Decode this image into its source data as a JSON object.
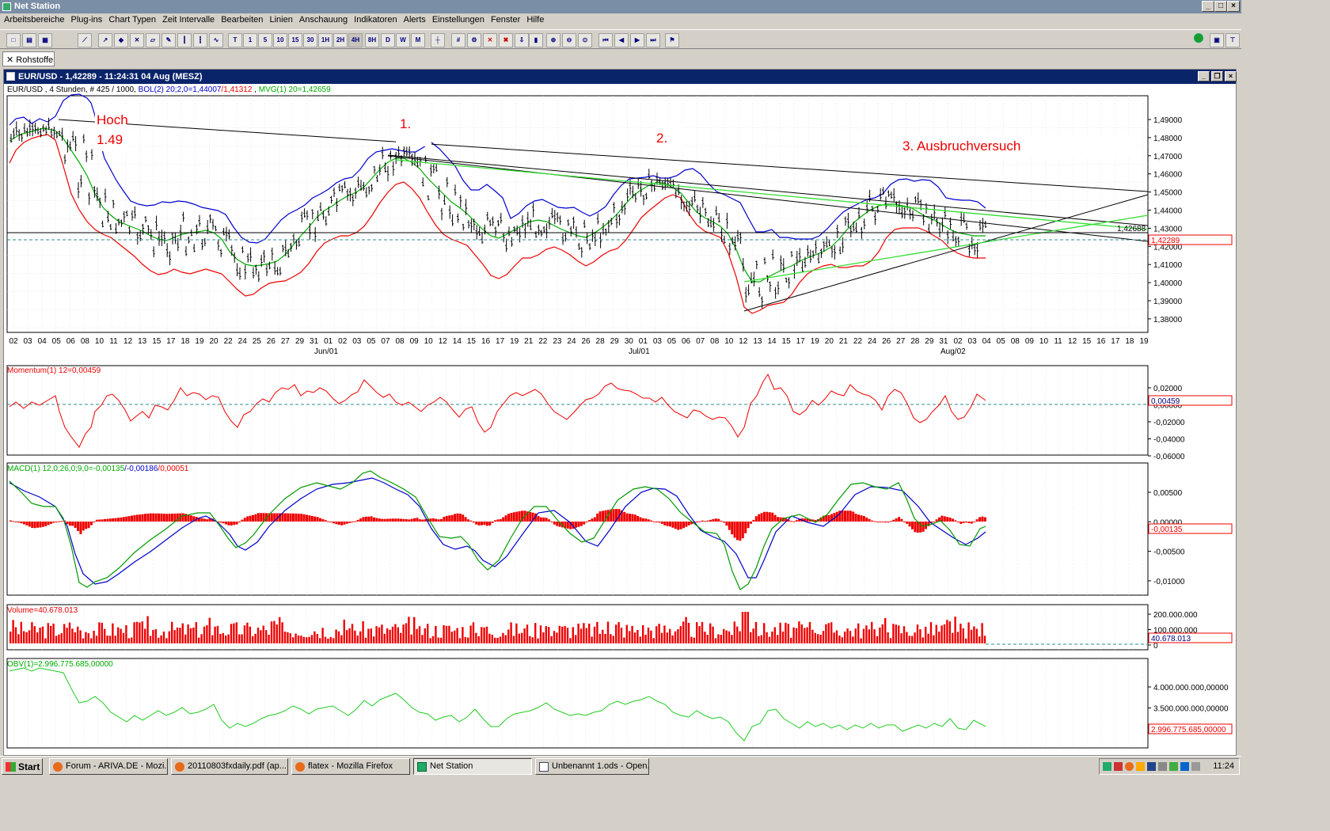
{
  "app": {
    "title": "Net Station"
  },
  "menu": [
    "Arbeitsbereiche",
    "Plug-ins",
    "Chart Typen",
    "Zeit Intervalle",
    "Bearbeiten",
    "Linien",
    "Anschauung",
    "Indikatoren",
    "Alerts",
    "Einstellungen",
    "Fenster",
    "Hilfe"
  ],
  "toolbar": {
    "intervals": [
      "T",
      "1",
      "5",
      "10",
      "15",
      "30",
      "1H",
      "2H",
      "4H",
      "8H",
      "D",
      "W",
      "M"
    ]
  },
  "tab": {
    "label": "Rohstoffe"
  },
  "chart_window": {
    "title": "EUR/USD - 1,42289 - 11:24:31  04 Aug (MESZ)"
  },
  "price_panel": {
    "info_prefix": "EUR/USD , 4 Stunden, # 425 / 1000, ",
    "bol_label": "BOL(2) 20;2,0=1,44007",
    "bol_lower": "/1,41312",
    "mvg_label": "MVG(1) 20=1,42659",
    "y_ticks": [
      "1,49000",
      "1,48000",
      "1,47000",
      "1,46000",
      "1,45000",
      "1,44000",
      "1,43000",
      "1,42000",
      "1,41000",
      "1,40000",
      "1,39000",
      "1,38000"
    ],
    "last_price": "1,42289",
    "line_price": "1,42688",
    "annotations": {
      "hoch": "Hoch",
      "hoch_value": "1.49",
      "first": "1.",
      "second": "2.",
      "third": "3. Ausbruchversuch"
    },
    "x_ticks": [
      "02",
      "03",
      "04",
      "05",
      "06",
      "08",
      "10",
      "11",
      "12",
      "13",
      "15",
      "17",
      "18",
      "19",
      "20",
      "22",
      "24",
      "25",
      "26",
      "27",
      "29",
      "31",
      "01",
      "02",
      "03",
      "05",
      "07",
      "08",
      "09",
      "10",
      "12",
      "14",
      "15",
      "16",
      "17",
      "19",
      "21",
      "22",
      "23",
      "24",
      "26",
      "28",
      "29",
      "30",
      "01",
      "03",
      "05",
      "06",
      "07",
      "08",
      "10",
      "12",
      "13",
      "14",
      "15",
      "17",
      "19",
      "20",
      "21",
      "22",
      "24",
      "26",
      "27",
      "28",
      "29",
      "31",
      "02",
      "03",
      "04",
      "05",
      "08",
      "09",
      "10",
      "11",
      "12",
      "15",
      "16",
      "17",
      "18",
      "19"
    ],
    "month_labels": [
      "Jun/01",
      "Jul/01",
      "Aug/02"
    ]
  },
  "momentum_panel": {
    "label": "Momentum(1) 12=0,00459",
    "y_ticks": [
      "0,02000",
      "0,00000",
      "-0,02000",
      "-0,04000",
      "-0,06000"
    ],
    "current": "0,00459"
  },
  "macd_panel": {
    "label_prefix": "MACD(1) 12,0;26,0;9,0=",
    "v1": "-0,00135",
    "v2": "/-0,00186",
    "v3": "/0,00051",
    "y_ticks": [
      "0,00500",
      "0,00000",
      "-0,00500",
      "-0,01000"
    ],
    "current": "-0,00135"
  },
  "volume_panel": {
    "label": "Volume=40.678.013",
    "y_ticks": [
      "200.000.000",
      "100.000.000",
      "0"
    ],
    "current": "40.678.013"
  },
  "obv_panel": {
    "label": "OBV(1)=2.996.775.685,00000",
    "y_ticks": [
      "4.000.000.000,00000",
      "3.500.000.000,00000",
      "3.000.000.000,00000"
    ],
    "current": "2.996.775.685,00000"
  },
  "taskbar": {
    "start": "Start",
    "tasks": [
      "Forum - ARIVA.DE - Mozi...",
      "20110803fxdaily.pdf (ap...",
      "flatex - Mozilla Firefox",
      "Net Station",
      "Unbenannt 1.ods - Open..."
    ],
    "clock": "11:24"
  },
  "colors": {
    "bollinger": "#0000cc",
    "bollinger_lower": "#ee0000",
    "moving_average": "#00aa00",
    "title_active": "#0a246a",
    "annotation": "#ee0000"
  }
}
